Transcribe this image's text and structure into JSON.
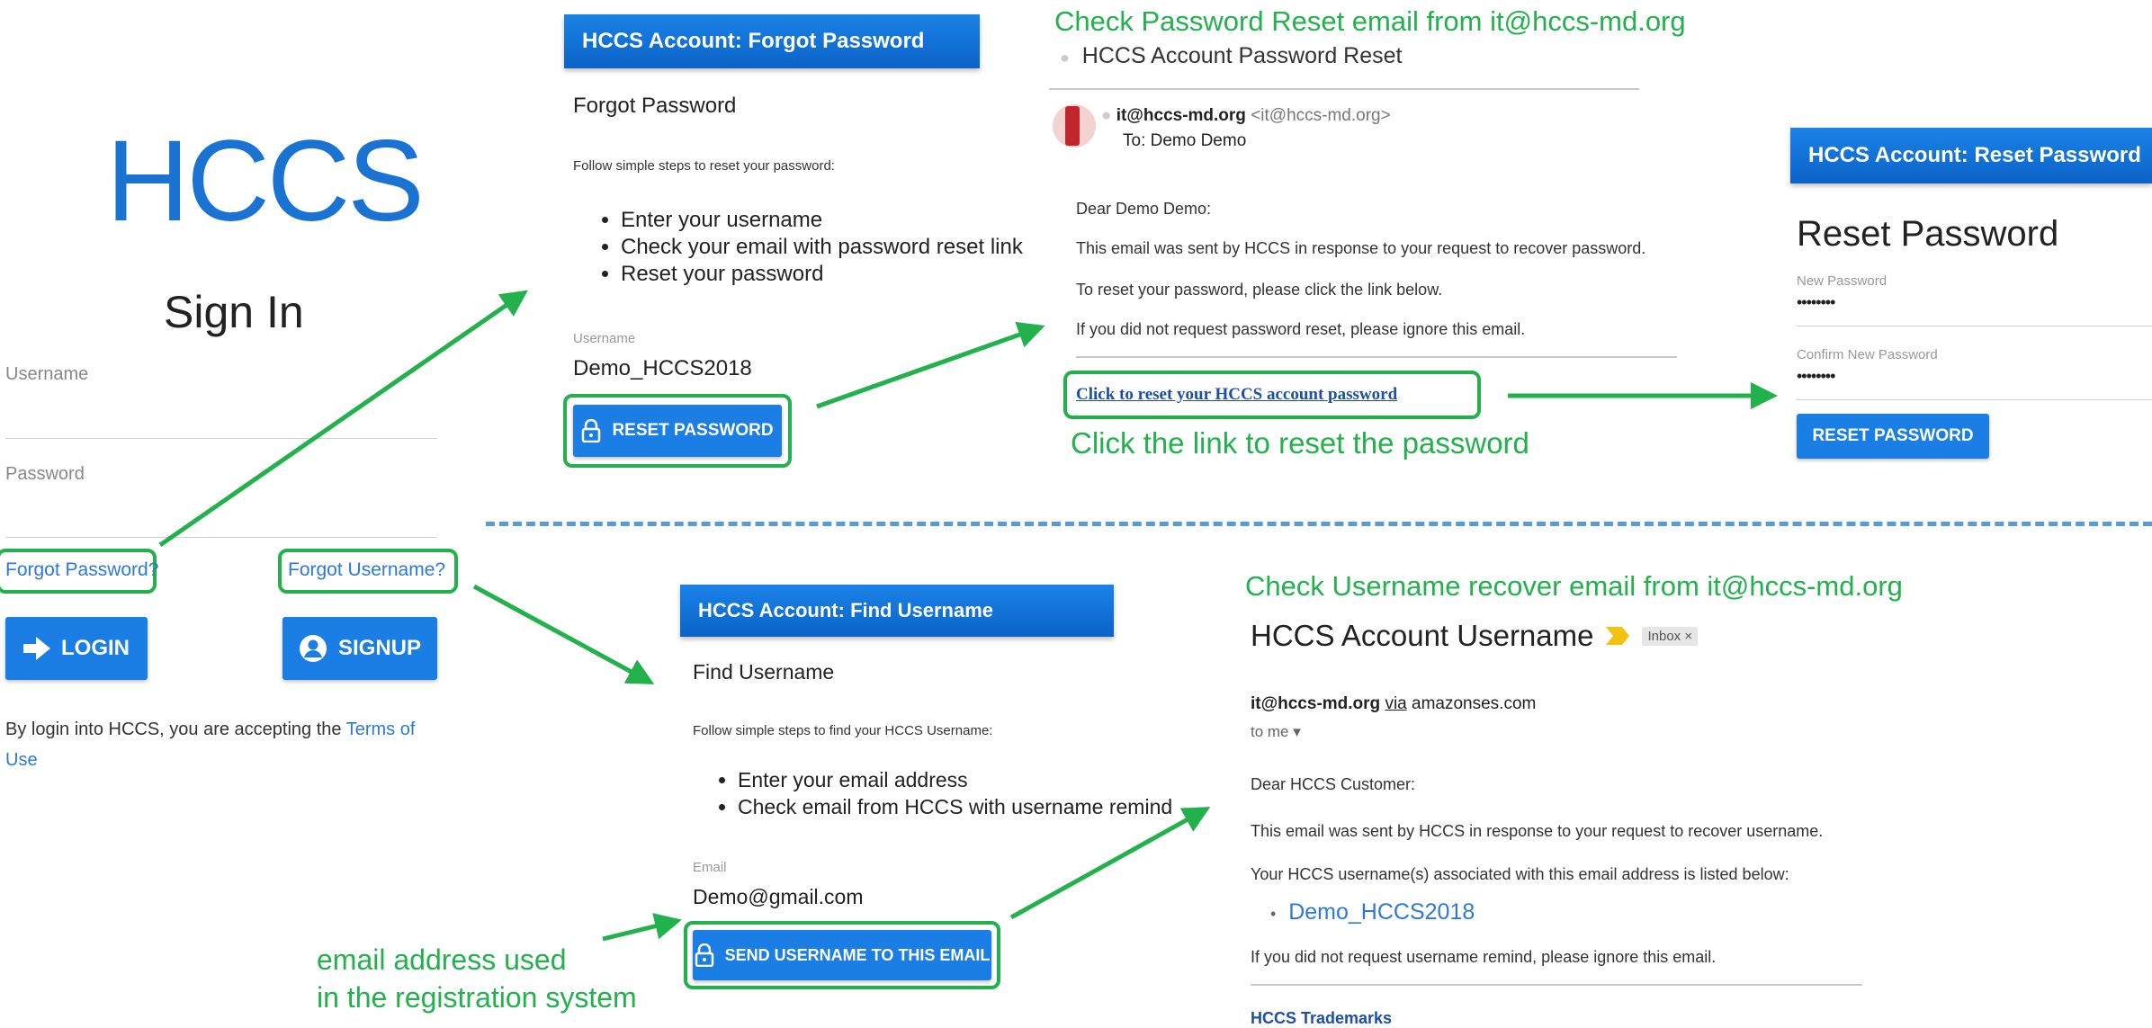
{
  "signin": {
    "logo": "HCCS",
    "title": "Sign In",
    "username_label": "Username",
    "password_label": "Password",
    "forgot_password": "Forgot Password?",
    "forgot_username": "Forgot Username?",
    "login": "LOGIN",
    "signup": "SIGNUP",
    "terms_prefix": "By login into HCCS, you are accepting the ",
    "terms_link_1": "Terms of",
    "terms_link_2": "Use"
  },
  "forgot_password": {
    "header": "HCCS Account: Forgot Password",
    "title": "Forgot Password",
    "intro": "Follow simple steps to reset your password:",
    "steps": [
      "Enter your username",
      "Check your email with password reset link",
      "Reset your password"
    ],
    "username_label": "Username",
    "username_value": "Demo_HCCS2018",
    "button": "RESET PASSWORD"
  },
  "reset_email": {
    "caption": "Check Password Reset email from it@hccs-md.org",
    "subject": "HCCS Account Password Reset",
    "sender_name": "it@hccs-md.org",
    "sender_addr": "<it@hccs-md.org>",
    "to": "To: Demo Demo",
    "greeting": "Dear Demo Demo:",
    "line1": "This email was sent by HCCS in response to your request to recover password.",
    "line2": "To reset your password, please click the link below.",
    "line3": "If you did not request password reset, please ignore this email.",
    "link": "Click to reset your HCCS account password",
    "link_caption": "Click the link to reset the password"
  },
  "reset_password": {
    "header": "HCCS Account: Reset Password",
    "title": "Reset Password",
    "new_label": "New Password",
    "new_value": "••••••••",
    "confirm_label": "Confirm New Password",
    "confirm_value": "••••••••",
    "button": "RESET PASSWORD"
  },
  "find_username": {
    "header": "HCCS Account: Find Username",
    "title": "Find Username",
    "intro": "Follow simple steps to find your HCCS Username:",
    "steps": [
      "Enter your email address",
      "Check email from HCCS with username remind"
    ],
    "email_label": "Email",
    "email_value": "Demo@gmail.com",
    "button": "SEND USERNAME TO THIS EMAIL",
    "note_line1": "email address used",
    "note_line2": "in the registration system"
  },
  "username_email": {
    "caption": "Check Username recover email from it@hccs-md.org",
    "subject": "HCCS Account Username",
    "inbox_badge": "Inbox ×",
    "sender_name": "it@hccs-md.org",
    "via": "via",
    "via_domain": "amazonses.com",
    "to": "to me ▾",
    "greeting": "Dear HCCS Customer:",
    "line1": "This email was sent by HCCS in response to your request to recover username.",
    "line2": "Your HCCS username(s) associated with this email address is listed below:",
    "username": "Demo_HCCS2018",
    "line3": "If you did not request username remind, please ignore this email.",
    "footer": "HCCS Trademarks"
  },
  "colors": {
    "accent": "#1a7ee4",
    "annotation": "#22b14c",
    "divider": "#5b9bd5"
  }
}
